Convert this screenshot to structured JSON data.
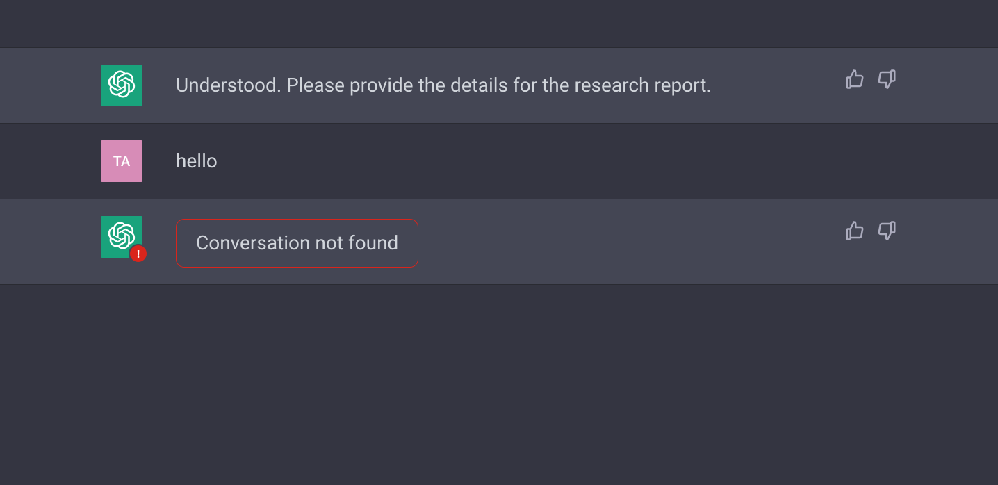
{
  "messages": [
    {
      "role": "assistant",
      "text": "Understood. Please provide the details for the research report.",
      "hasError": false,
      "hasFeedback": true
    },
    {
      "role": "user",
      "avatarText": "TA",
      "text": "hello",
      "hasError": false,
      "hasFeedback": false
    },
    {
      "role": "assistant",
      "errorText": "Conversation not found",
      "hasError": true,
      "hasFeedback": true
    }
  ]
}
